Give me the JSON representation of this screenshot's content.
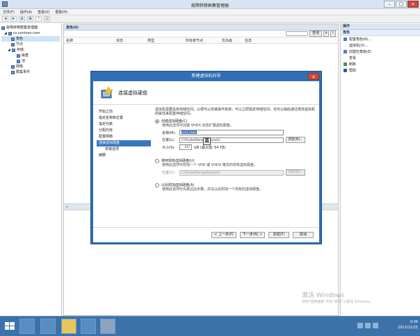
{
  "window": {
    "title": "故障转移群集管理器"
  },
  "menu": [
    "文件(F)",
    "操作(A)",
    "查看(V)",
    "帮助(H)"
  ],
  "tree": [
    {
      "label": "故障转移群集管理器",
      "indent": 0
    },
    {
      "label": "cs.contoso.com",
      "indent": 1
    },
    {
      "label": "角色",
      "indent": 2,
      "selected": true
    },
    {
      "label": "节点",
      "indent": 2
    },
    {
      "label": "存储",
      "indent": 2
    },
    {
      "label": "磁盘",
      "indent": 3
    },
    {
      "label": "池",
      "indent": 3
    },
    {
      "label": "网络",
      "indent": 2
    },
    {
      "label": "群集事件",
      "indent": 2
    }
  ],
  "center": {
    "header": "角色(0)",
    "filter_placeholder": "",
    "query_label": "查询",
    "columns": [
      "名称",
      "状态",
      "类型",
      "所有者节点",
      "优先级",
      "信息"
    ]
  },
  "actions": {
    "header": "操作",
    "section": "角色",
    "items": [
      {
        "label": "配置角色(R)...",
        "icon": "config-icon",
        "color": "#4b7fc4"
      },
      {
        "label": "虚拟机(V)...",
        "icon": "vm-icon",
        "color": "#ffffff"
      },
      {
        "label": "创建空角色(E)",
        "icon": "empty-role-icon",
        "color": "#4b7fc4"
      },
      {
        "label": "查看",
        "icon": "view-icon",
        "color": "#ffffff"
      },
      {
        "label": "刷新",
        "icon": "refresh-icon",
        "color": "#3a9a3a"
      },
      {
        "label": "帮助",
        "icon": "help-icon",
        "color": "#2a5fb0"
      }
    ]
  },
  "dialog": {
    "title": "新建虚拟机向导",
    "heading": "连接虚拟硬盘",
    "steps": [
      {
        "label": "开始之前",
        "sub": false,
        "active": false
      },
      {
        "label": "指定名称和位置",
        "sub": false,
        "active": false
      },
      {
        "label": "指定代数",
        "sub": false,
        "active": false
      },
      {
        "label": "分配内存",
        "sub": false,
        "active": false
      },
      {
        "label": "配置网络",
        "sub": false,
        "active": false
      },
      {
        "label": "连接虚拟硬盘",
        "sub": false,
        "active": true
      },
      {
        "label": "安装选项",
        "sub": true,
        "active": false
      },
      {
        "label": "摘要",
        "sub": false,
        "active": false
      }
    ],
    "intro": "虚拟机需要具有存储空间，以便可以安装操作系统。可以立即指定存储空间，也可以稍后通过修改虚拟机的属性来配置存储空间。",
    "option1": {
      "label": "创建虚拟硬盘(C)",
      "desc": "使用此选项可创建 VHDX 动态扩展虚拟硬盘。",
      "name_label": "名称(M):",
      "name_value": "vm1.vhdx",
      "location_label": "位置(L):",
      "location_value": "C:\\ClusterStorage\\Volume1\\",
      "browse": "浏览(B)...",
      "size_label": "大小(S):",
      "size_value": "127",
      "size_unit": "GB (最大值: 64 TB)"
    },
    "option2": {
      "label": "使用现有虚拟硬盘(U)",
      "desc": "使用此选项可附加一个 VHD 或 VHDX 格式的现有虚拟硬盘。",
      "location_label": "位置(C):",
      "location_value": "C:\\ClusterStorage\\Volume1\\",
      "browse": "浏览(B)..."
    },
    "option3": {
      "label": "以后附加虚拟硬盘(A)",
      "desc": "使用此选项可先跳过此步骤，并在以后附加一个现有的虚拟硬盘。"
    },
    "buttons": {
      "prev": "< 上一步(P)",
      "next": "下一步(N) >",
      "finish": "完成(F)",
      "cancel": "取消"
    },
    "ime": "英"
  },
  "watermark": {
    "line1": "激活 Windows",
    "line2": "转到\"控制面板\"中的\"系统\"以激活 Windows。"
  },
  "taskbar": {
    "time": "9:36",
    "date": "2013/12/25"
  },
  "colors": {
    "accent": "#2f6fb5",
    "taskbar": "#3d72a8",
    "selection": "#3a76c0"
  }
}
